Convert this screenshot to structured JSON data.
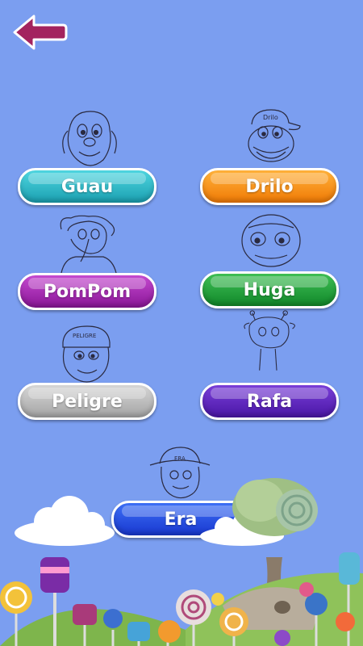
{
  "back": {
    "icon": "back-arrow-icon",
    "color": "#a3235f"
  },
  "characters": [
    {
      "id": "guau",
      "label": "Guau",
      "color_top": "#4fd6e0",
      "color_bottom": "#1a9fb0"
    },
    {
      "id": "drilo",
      "label": "Drilo",
      "color_top": "#ffb13a",
      "color_bottom": "#f07a05"
    },
    {
      "id": "pompom",
      "label": "PomPom",
      "color_top": "#c54ad0",
      "color_bottom": "#8a1697"
    },
    {
      "id": "huga",
      "label": "Huga",
      "color_top": "#3fbf55",
      "color_bottom": "#11882a"
    },
    {
      "id": "peligre",
      "label": "Peligre",
      "color_top": "#d6d6d6",
      "color_bottom": "#a4a4a4"
    },
    {
      "id": "rafa",
      "label": "Rafa",
      "color_top": "#7a3fd8",
      "color_bottom": "#4a16a6"
    },
    {
      "id": "era",
      "label": "Era",
      "color_top": "#3d6ff5",
      "color_bottom": "#1838d0"
    }
  ],
  "drilo_cap_text": "Drilo",
  "pelig_cap_text": "PELIGRE",
  "era_hat_text": "ERA"
}
